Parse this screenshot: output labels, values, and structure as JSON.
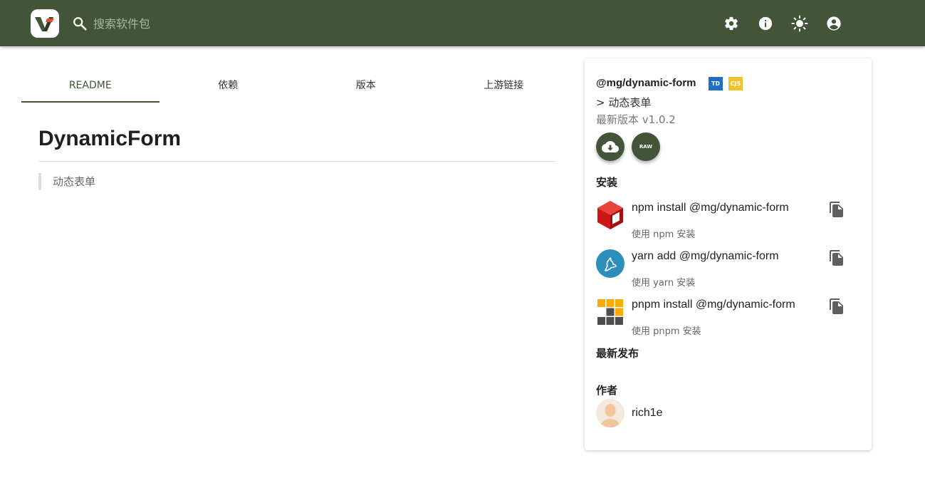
{
  "header": {
    "search_placeholder": "搜索软件包",
    "icons": [
      "settings-icon",
      "info-icon",
      "theme-icon",
      "account-icon"
    ],
    "color": "#435539"
  },
  "tabs": [
    {
      "label": "README",
      "active": true
    },
    {
      "label": "依赖",
      "active": false
    },
    {
      "label": "版本",
      "active": false
    },
    {
      "label": "上游链接",
      "active": false
    }
  ],
  "readme": {
    "title": "DynamicForm",
    "quote": "动态表单"
  },
  "package": {
    "name": "@mg/dynamic-form",
    "badges": [
      "TD",
      "CJS"
    ],
    "description": "> 动态表单",
    "version": "最新版本 v1.0.2",
    "raw_label": "RAW"
  },
  "install": {
    "title": "安装",
    "items": [
      {
        "command": "npm install @mg/dynamic-form",
        "note": "使用 npm 安装",
        "icon": "npm-icon"
      },
      {
        "command": "yarn add @mg/dynamic-form",
        "note": "使用 yarn 安装",
        "icon": "yarn-icon"
      },
      {
        "command": "pnpm install @mg/dynamic-form",
        "note": "使用 pnpm 安装",
        "icon": "pnpm-icon"
      }
    ]
  },
  "latest_release": {
    "title": "最新发布"
  },
  "author": {
    "title": "作者",
    "name": "rich1e"
  }
}
